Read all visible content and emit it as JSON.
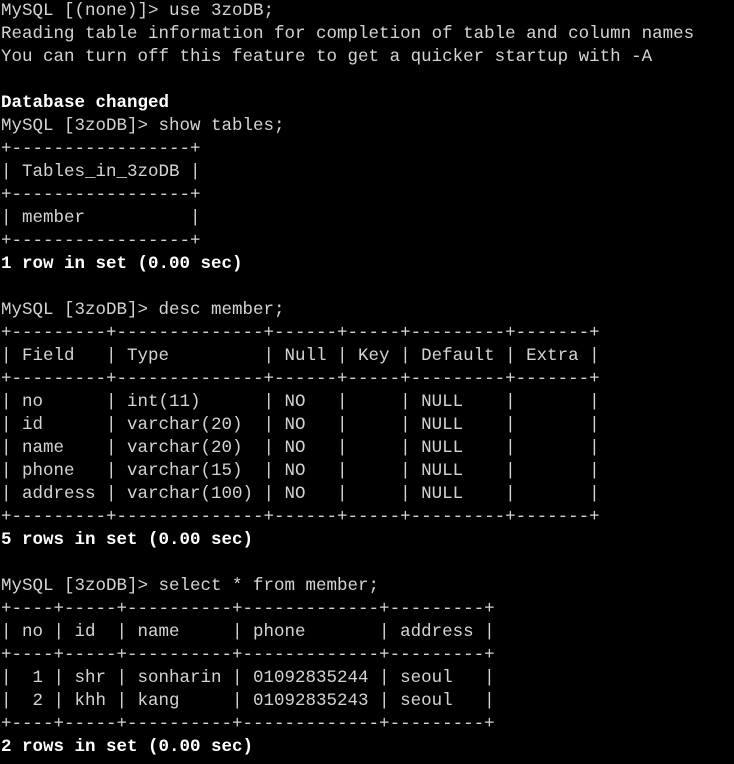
{
  "terminal": {
    "colors": {
      "background": "#000000",
      "foreground": "#d4d4d4",
      "bold": "#ffffff"
    },
    "lines": [
      {
        "text": "MySQL [(none)]> use 3zoDB;",
        "bold": false
      },
      {
        "text": "Reading table information for completion of table and column names",
        "bold": false
      },
      {
        "text": "You can turn off this feature to get a quicker startup with -A",
        "bold": false
      },
      {
        "text": "",
        "bold": false
      },
      {
        "text": "Database changed",
        "bold": true
      },
      {
        "text": "MySQL [3zoDB]> show tables;",
        "bold": false
      },
      {
        "text": "+-----------------+",
        "bold": false
      },
      {
        "text": "| Tables_in_3zoDB |",
        "bold": false
      },
      {
        "text": "+-----------------+",
        "bold": false
      },
      {
        "text": "| member          |",
        "bold": false
      },
      {
        "text": "+-----------------+",
        "bold": false
      },
      {
        "text": "1 row in set (0.00 sec)",
        "bold": true
      },
      {
        "text": "",
        "bold": false
      },
      {
        "text": "MySQL [3zoDB]> desc member;",
        "bold": false
      },
      {
        "text": "+---------+--------------+------+-----+---------+-------+",
        "bold": false
      },
      {
        "text": "| Field   | Type         | Null | Key | Default | Extra |",
        "bold": false
      },
      {
        "text": "+---------+--------------+------+-----+---------+-------+",
        "bold": false
      },
      {
        "text": "| no      | int(11)      | NO   |     | NULL    |       |",
        "bold": false
      },
      {
        "text": "| id      | varchar(20)  | NO   |     | NULL    |       |",
        "bold": false
      },
      {
        "text": "| name    | varchar(20)  | NO   |     | NULL    |       |",
        "bold": false
      },
      {
        "text": "| phone   | varchar(15)  | NO   |     | NULL    |       |",
        "bold": false
      },
      {
        "text": "| address | varchar(100) | NO   |     | NULL    |       |",
        "bold": false
      },
      {
        "text": "+---------+--------------+------+-----+---------+-------+",
        "bold": false
      },
      {
        "text": "5 rows in set (0.00 sec)",
        "bold": true
      },
      {
        "text": "",
        "bold": false
      },
      {
        "text": "MySQL [3zoDB]> select * from member;",
        "bold": false
      },
      {
        "text": "+----+-----+----------+-------------+---------+",
        "bold": false
      },
      {
        "text": "| no | id  | name     | phone       | address |",
        "bold": false
      },
      {
        "text": "+----+-----+----------+-------------+---------+",
        "bold": false
      },
      {
        "text": "|  1 | shr | sonharin | 01092835244 | seoul   |",
        "bold": false
      },
      {
        "text": "|  2 | khh | kang     | 01092835243 | seoul   |",
        "bold": false
      },
      {
        "text": "+----+-----+----------+-------------+---------+",
        "bold": false
      },
      {
        "text": "2 rows in set (0.00 sec)",
        "bold": true
      }
    ]
  }
}
